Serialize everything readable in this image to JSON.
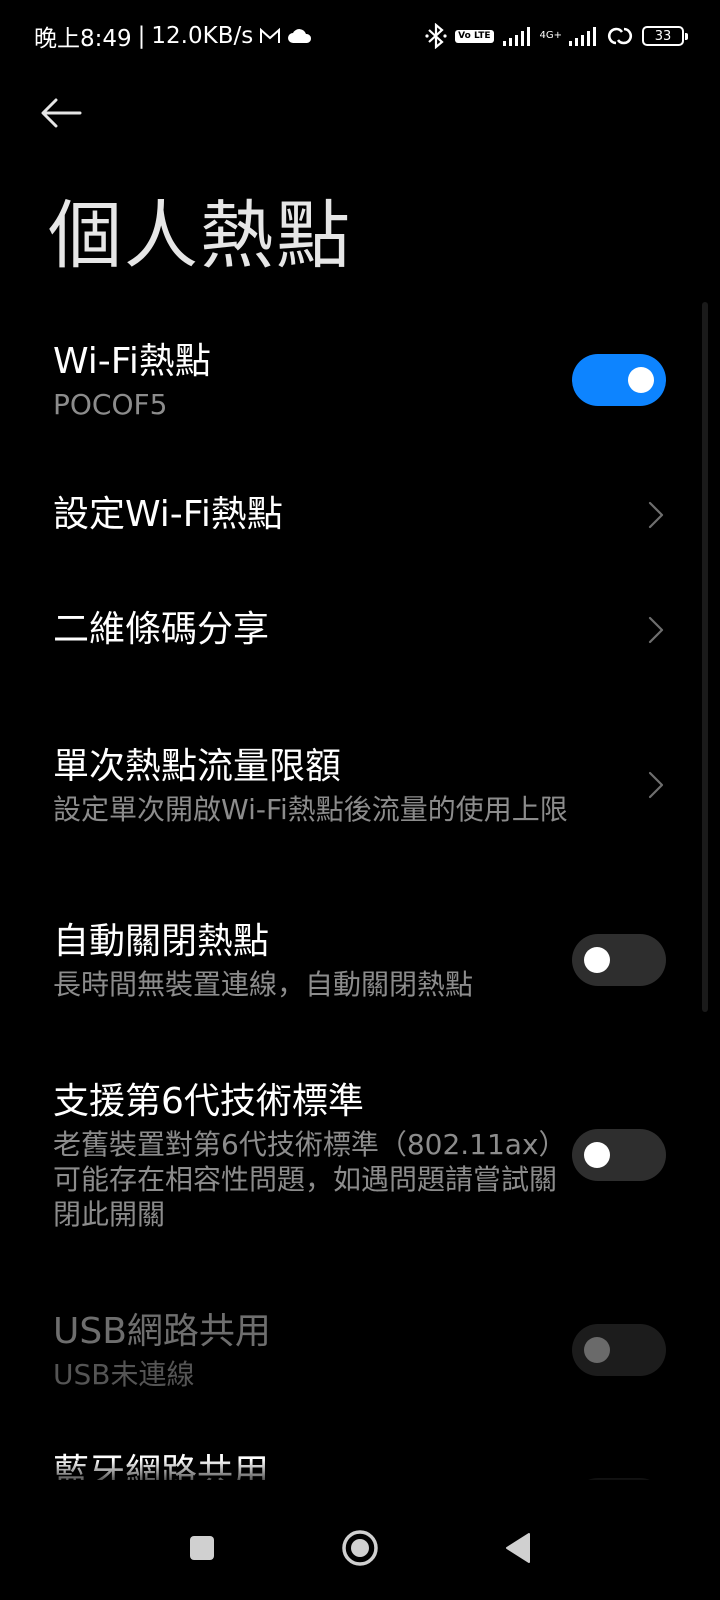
{
  "status_bar": {
    "time": "晚上8:49",
    "speed": "12.0KB/s",
    "network_type": "4G+",
    "volte_label": "Vo LTE",
    "battery": "33"
  },
  "page": {
    "title": "個人熱點"
  },
  "items": [
    {
      "title": "Wi-Fi熱點",
      "subtitle": "POCOF5",
      "control": "switch",
      "state": "on"
    },
    {
      "title": "設定Wi-Fi熱點",
      "control": "chevron"
    },
    {
      "title": "二維條碼分享",
      "control": "chevron"
    },
    {
      "title": "單次熱點流量限額",
      "subtitle": "設定單次開啟Wi-Fi熱點後流量的使用上限",
      "control": "chevron"
    },
    {
      "title": "自動關閉熱點",
      "subtitle": "長時間無裝置連線，自動關閉熱點",
      "control": "switch",
      "state": "off"
    },
    {
      "title": "支援第6代技術標準",
      "subtitle": "老舊裝置對第6代技術標準（802.11ax）可能存在相容性問題，如遇問題請嘗試關閉此開關",
      "control": "switch",
      "state": "off"
    },
    {
      "title": "USB網路共用",
      "subtitle": "USB未連線",
      "control": "switch",
      "state": "disabled"
    },
    {
      "title": "藍牙網路共用"
    }
  ],
  "colors": {
    "accent": "#0d84ff",
    "background": "#000000",
    "title_text": "#ffffff",
    "subtitle_text": "#8c8c8c"
  },
  "icons": {
    "back": "arrow-left-icon",
    "chevron": "chevron-right-icon",
    "nav_recents": "square-icon",
    "nav_home": "circle-icon",
    "nav_back": "triangle-back-icon"
  }
}
